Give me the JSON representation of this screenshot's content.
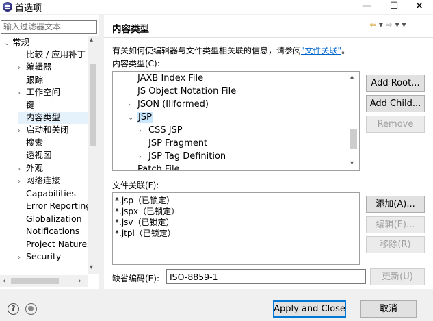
{
  "window": {
    "title": "首选项",
    "minimize": "—",
    "maximize": "☐",
    "close": "✕"
  },
  "left": {
    "filter_placeholder": "输入过滤器文本",
    "tree": [
      {
        "label": "常规",
        "twisty": "⌄",
        "level": 0
      },
      {
        "label": "比较 / 应用补丁",
        "twisty": "",
        "level": 1
      },
      {
        "label": "编辑器",
        "twisty": "›",
        "level": 1
      },
      {
        "label": "跟踪",
        "twisty": "",
        "level": 1
      },
      {
        "label": "工作空间",
        "twisty": "›",
        "level": 1
      },
      {
        "label": "键",
        "twisty": "",
        "level": 1
      },
      {
        "label": "内容类型",
        "twisty": "",
        "level": 1,
        "selected": true
      },
      {
        "label": "启动和关闭",
        "twisty": "›",
        "level": 1
      },
      {
        "label": "搜索",
        "twisty": "",
        "level": 1
      },
      {
        "label": "透视图",
        "twisty": "",
        "level": 1
      },
      {
        "label": "外观",
        "twisty": "›",
        "level": 1
      },
      {
        "label": "网络连接",
        "twisty": "›",
        "level": 1
      },
      {
        "label": "Capabilities",
        "twisty": "",
        "level": 1
      },
      {
        "label": "Error Reporting",
        "twisty": "",
        "level": 1
      },
      {
        "label": "Globalization",
        "twisty": "",
        "level": 1
      },
      {
        "label": "Notifications",
        "twisty": "",
        "level": 1
      },
      {
        "label": "Project Natures",
        "twisty": "",
        "level": 1
      },
      {
        "label": "Security",
        "twisty": "›",
        "level": 1
      }
    ]
  },
  "right": {
    "title": "内容类型",
    "nav": {
      "back": "⇦",
      "back_menu": "▾",
      "forward": "⇨",
      "forward_menu": "▾",
      "menu": "▾"
    },
    "description_prefix": "有关如何使编辑器与文件类型相关联的信息，请参阅",
    "description_link": "\"文件关联\"",
    "description_suffix": "。",
    "content_types_label": "内容类型(C):",
    "content_types": [
      {
        "label": "JAXB Index File",
        "twisty": "",
        "indent": 2
      },
      {
        "label": "JS Object Notation File",
        "twisty": "",
        "indent": 2
      },
      {
        "label": "JSON (Illformed)",
        "twisty": "›",
        "indent": 1
      },
      {
        "label": "JSP",
        "twisty": "⌄",
        "indent": 1,
        "selected": true
      },
      {
        "label": "CSS JSP",
        "twisty": "›",
        "indent": 2
      },
      {
        "label": "JSP Fragment",
        "twisty": "",
        "indent": 3
      },
      {
        "label": "JSP Tag Definition",
        "twisty": "›",
        "indent": 2
      },
      {
        "label": "Patch File",
        "twisty": "",
        "indent": 2
      }
    ],
    "buttons": {
      "add_root": "Add Root...",
      "add_child": "Add Child...",
      "remove": "Remove",
      "add": "添加(A)...",
      "edit": "编辑(E)...",
      "delete": "移除(R)",
      "update": "更新(U)"
    },
    "file_assoc_label": "文件关联(F):",
    "file_associations": [
      "*.jsp（已锁定）",
      "*.jspx（已锁定）",
      "*.jsv（已锁定）",
      "*.jtpl（已锁定）"
    ],
    "encoding_label": "缺省编码(E):",
    "encoding_value": "ISO-8859-1"
  },
  "footer": {
    "help_icon": "?",
    "apply_close": "Apply and Close",
    "cancel": "取消"
  },
  "icons": {
    "up": "▴",
    "down": "▾",
    "left": "‹",
    "right": "›"
  }
}
